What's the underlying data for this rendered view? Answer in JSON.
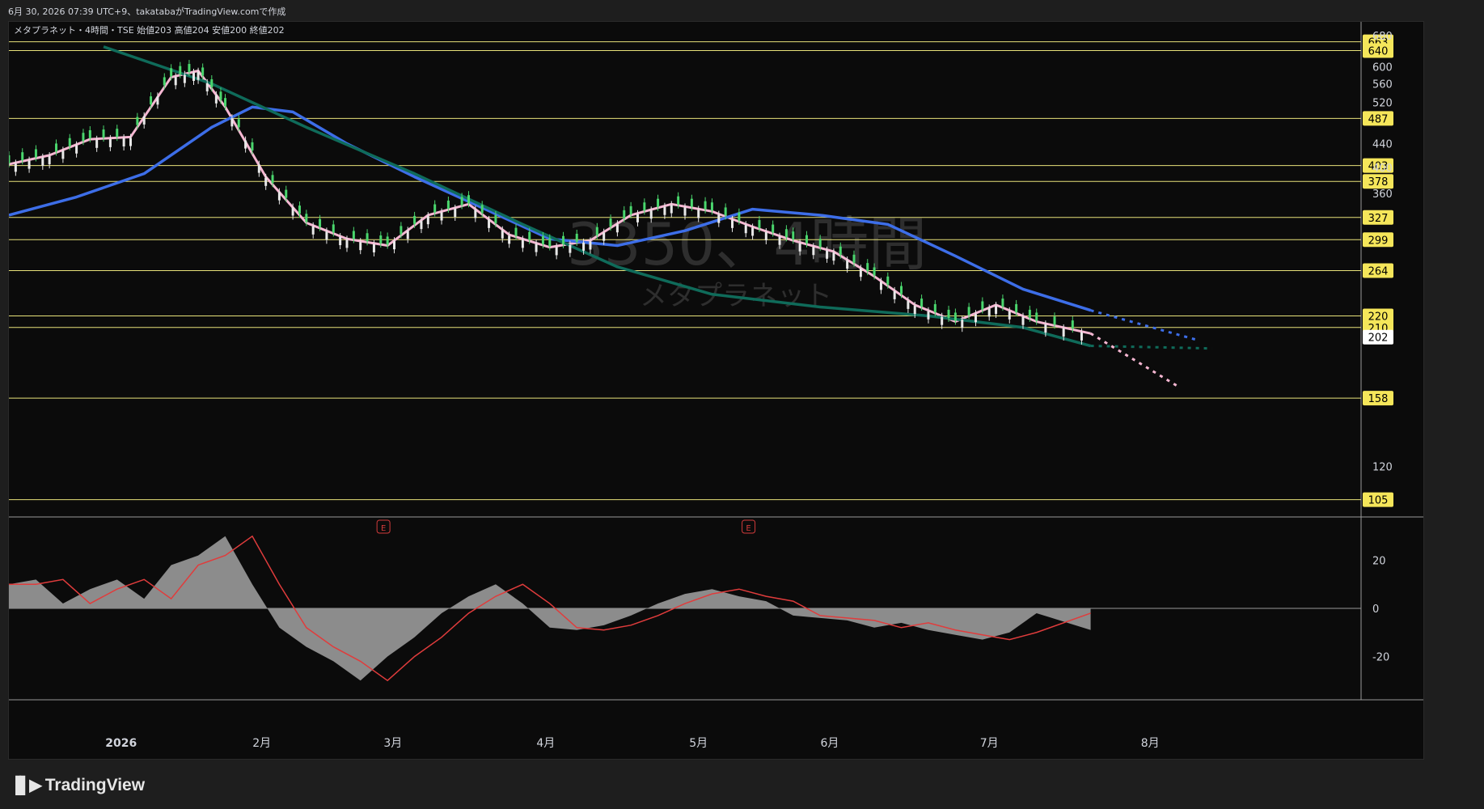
{
  "header": {
    "created": "6月 30, 2026 07:39 UTC+9、takatabaがTradingView.comで作成"
  },
  "legend": {
    "symbol": "メタプラネット・4時間・TSE",
    "o_label": "始値",
    "o": "203",
    "h_label": "高値",
    "h": "204",
    "l_label": "安値",
    "l": "200",
    "c_label": "終値",
    "c": "202"
  },
  "watermark": {
    "code": "3350、4時間",
    "name": "メタプラネット"
  },
  "brand": {
    "name": "TradingView",
    "logo": "tradingview-logo"
  },
  "earnings_marker": "E",
  "colors": {
    "background": "#0b0b0b",
    "level": "#e8e27a",
    "label_bg": "#f5e65a",
    "ema_fast": "#f6b7d2",
    "ema_mid": "#3d6ee8",
    "ema_long": "#0f6b5a",
    "bb": "#4a8fe0",
    "last_price_bg": "#ffffff"
  },
  "chart_data": [
    {
      "type": "line",
      "title": "メタプラネット・4時間・TSE",
      "x_ticks": [
        "2026",
        "2月",
        "3月",
        "4月",
        "5月",
        "6月",
        "7月",
        "8月"
      ],
      "y_ticks": [
        120,
        360,
        400,
        440,
        520,
        560,
        600,
        680
      ],
      "y_scale": "log",
      "ylim": [
        108,
        700
      ],
      "price_levels": [
        663,
        640,
        487,
        403,
        378,
        327,
        299,
        264,
        220,
        210,
        158,
        105
      ],
      "last_price": 202,
      "series": [
        {
          "color": "#f6b7d2",
          "x": [
            0,
            0.03,
            0.06,
            0.09,
            0.12,
            0.14,
            0.16,
            0.19,
            0.22,
            0.25,
            0.28,
            0.31,
            0.34,
            0.37,
            0.4,
            0.43,
            0.46,
            0.49,
            0.52,
            0.55,
            0.58,
            0.61,
            0.64,
            0.67,
            0.7,
            0.73,
            0.76,
            0.8
          ],
          "values": [
            405,
            420,
            448,
            452,
            575,
            590,
            510,
            385,
            320,
            300,
            292,
            330,
            345,
            305,
            290,
            298,
            330,
            345,
            335,
            315,
            298,
            285,
            258,
            230,
            215,
            230,
            215,
            205
          ]
        },
        {
          "color": "#3d6ee8",
          "x": [
            0,
            0.05,
            0.1,
            0.15,
            0.18,
            0.21,
            0.25,
            0.3,
            0.35,
            0.4,
            0.45,
            0.5,
            0.55,
            0.6,
            0.65,
            0.7,
            0.75,
            0.8
          ],
          "values": [
            330,
            355,
            390,
            470,
            510,
            500,
            440,
            385,
            340,
            300,
            292,
            310,
            338,
            330,
            318,
            280,
            245,
            225
          ]
        },
        {
          "color": "#0f6b5a",
          "x": [
            0.07,
            0.15,
            0.22,
            0.3,
            0.38,
            0.45,
            0.52,
            0.6,
            0.68,
            0.75,
            0.8
          ],
          "values": [
            650,
            560,
            470,
            390,
            318,
            268,
            240,
            228,
            220,
            210,
            195
          ]
        }
      ]
    },
    {
      "type": "area",
      "title": "",
      "y_ticks": [
        20,
        0,
        -20
      ],
      "ylim": [
        -38,
        38
      ],
      "x": [
        0,
        0.02,
        0.04,
        0.06,
        0.08,
        0.1,
        0.12,
        0.14,
        0.16,
        0.18,
        0.2,
        0.22,
        0.24,
        0.26,
        0.28,
        0.3,
        0.32,
        0.34,
        0.36,
        0.38,
        0.4,
        0.42,
        0.44,
        0.46,
        0.48,
        0.5,
        0.52,
        0.54,
        0.56,
        0.58,
        0.6,
        0.62,
        0.64,
        0.66,
        0.68,
        0.7,
        0.72,
        0.74,
        0.76,
        0.8
      ],
      "values": [
        10,
        12,
        2,
        8,
        12,
        4,
        18,
        22,
        30,
        10,
        -8,
        -16,
        -22,
        -30,
        -20,
        -12,
        -2,
        5,
        10,
        2,
        -8,
        -9,
        -7,
        -3,
        2,
        6,
        8,
        5,
        3,
        -3,
        -4,
        -5,
        -8,
        -6,
        -9,
        -11,
        -13,
        -10,
        -2,
        -9
      ]
    }
  ]
}
